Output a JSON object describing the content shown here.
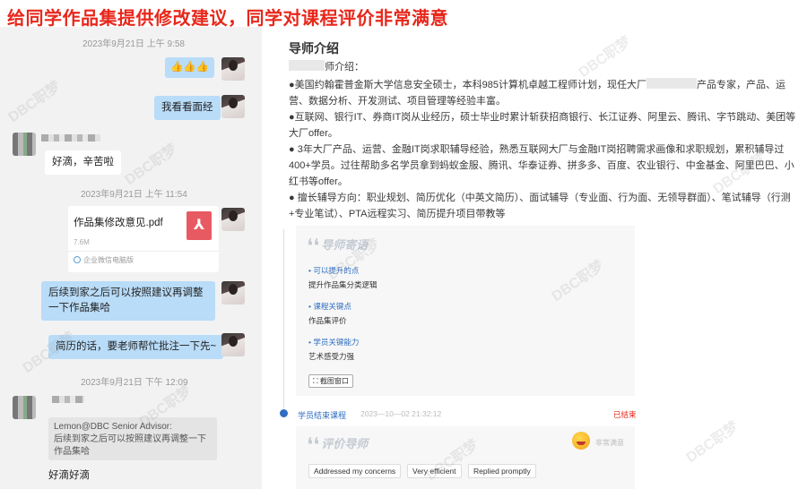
{
  "headline": "给同学作品集提供修改建议，同学对课程评价非常满意",
  "chat": {
    "timestamps": [
      "2023年9月21日 上午 9:58",
      "2023年9月21日 上午 11:54",
      "2023年9月21日 下午 12:09"
    ],
    "msg_emoji": "👍👍👍",
    "msg_look": "我看看面经",
    "msg_reply_1": "好滴，辛苦啦",
    "file": {
      "name": "作品集修改意见.pdf",
      "size": "7.6M",
      "source": "企业微信电脑版",
      "icon": "pdf-icon"
    },
    "msg_adjust": "后续到家之后可以按照建议再调整一下作品集哈",
    "msg_resume": "简历的话，要老师帮忙批注一下先~",
    "quote_author": "Lemon@DBC Senior Advisor:",
    "quote_text": "后续到家之后可以按照建议再调整一下作品集哈",
    "msg_reply_2": "好滴好滴"
  },
  "intro": {
    "title": "导师介绍",
    "label": "师介绍：",
    "p1": "●美国约翰霍普金斯大学信息安全硕士，本科985计算机卓越工程师计划，现任大厂",
    "p1_tail": "产品专家，产品、运营、数据分析、开发测试、项目管理等经验丰富。",
    "p2": "●互联网、银行IT、券商IT岗从业经历，硕士毕业时累计斩获招商银行、长江证券、阿里云、腾讯、字节跳动、美团等大厂offer。",
    "p3": "● 3年大厂产品、运营、金融IT岗求职辅导经验，熟悉互联网大厂与金融IT岗招聘需求画像和求职规划，累积辅导过400+学员。过往帮助多名学员拿到蚂蚁金服、腾讯、华泰证券、拼多多、百度、农业银行、中金基金、阿里巴巴、小红书等offer。",
    "p4": "● 擅长辅导方向：职业规划、简历优化（中英文简历）、面试辅导（专业面、行为面、无领导群面）、笔试辅导（行测+专业笔试）、PTA远程实习、简历提升项目带教等"
  },
  "notes": {
    "title": "导师寄语",
    "items": [
      {
        "label": "• 可以提升的点",
        "value": "提升作品集分类逻辑"
      },
      {
        "label": "• 课程关键点",
        "value": "作品集评价"
      },
      {
        "label": "• 学员关键能力",
        "value": "艺术感受力强"
      }
    ],
    "screenshot_btn": "截图窗口"
  },
  "event": {
    "label": "学员结束课程",
    "time": "2023—10—02 21:32:12",
    "status": "已结束"
  },
  "review": {
    "title": "评价导师",
    "emoji_label": "非常满意",
    "tags": [
      "Addressed my concerns",
      "Very efficient",
      "Replied promptly"
    ]
  },
  "colors": {
    "headline": "#e8271b",
    "bubble_right": "#b9dcf8",
    "accent": "#2f6ec2"
  },
  "watermark": "DBC职梦"
}
